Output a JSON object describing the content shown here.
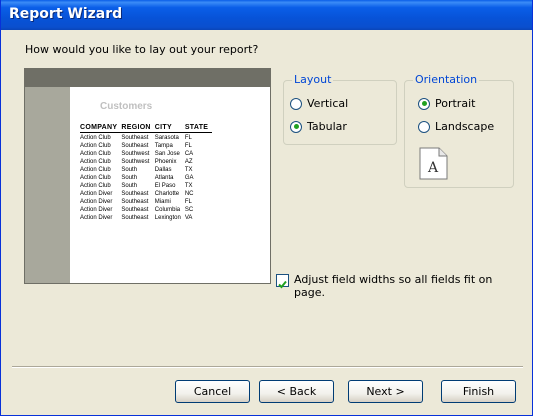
{
  "window": {
    "title": "Report Wizard"
  },
  "prompt": "How would you like to lay out your report?",
  "preview": {
    "title": "Customers",
    "columns": [
      "COMPANY",
      "REGION",
      "CITY",
      "STATE"
    ],
    "rows": [
      [
        "Action Club",
        "Southeast",
        "Sarasota",
        "FL"
      ],
      [
        "Action Club",
        "Southeast",
        "Tampa",
        "FL"
      ],
      [
        "Action Club",
        "Southwest",
        "San Jose",
        "CA"
      ],
      [
        "Action Club",
        "Southwest",
        "Phoenix",
        "AZ"
      ],
      [
        "Action Club",
        "South",
        "Dallas",
        "TX"
      ],
      [
        "Action Club",
        "South",
        "Atlanta",
        "GA"
      ],
      [
        "Action Club",
        "South",
        "El Paso",
        "TX"
      ],
      [
        "Action Diver",
        "Southeast",
        "Charlotte",
        "NC"
      ],
      [
        "Action Diver",
        "Southeast",
        "Miami",
        "FL"
      ],
      [
        "Action Diver",
        "Southeast",
        "Columbia",
        "SC"
      ],
      [
        "Action Diver",
        "Southeast",
        "Lexington",
        "VA"
      ]
    ]
  },
  "layout": {
    "label": "Layout",
    "options": [
      {
        "label": "Vertical",
        "selected": false
      },
      {
        "label": "Tabular",
        "selected": true
      }
    ]
  },
  "orientation": {
    "label": "Orientation",
    "options": [
      {
        "label": "Portrait",
        "selected": true
      },
      {
        "label": "Landscape",
        "selected": false
      }
    ],
    "icon": "portrait-page-icon",
    "icon_letter": "A"
  },
  "adjust": {
    "label": "Adjust field widths so all fields fit on page.",
    "checked": true
  },
  "buttons": {
    "cancel": "Cancel",
    "back": "< Back",
    "next": "Next >",
    "finish": "Finish"
  },
  "colors": {
    "title_bar": "#0a5ee8",
    "group_label": "#0046d5",
    "radio_dot": "#21a121"
  }
}
